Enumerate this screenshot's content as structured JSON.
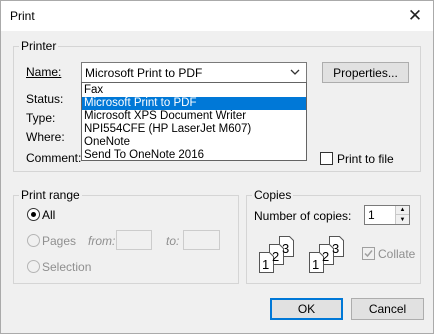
{
  "window": {
    "title": "Print",
    "close_glyph": "✕"
  },
  "printer": {
    "group_label": "Printer",
    "name_label": "Name:",
    "selected": "Microsoft Print to PDF",
    "properties_button": "Properties...",
    "status_label": "Status:",
    "type_label": "Type:",
    "where_label": "Where:",
    "comment_label": "Comment:",
    "print_to_file_label": "Print to file",
    "options": [
      "Fax",
      "Microsoft Print to PDF",
      "Microsoft XPS Document Writer",
      "NPI554CFE (HP LaserJet M607)",
      "OneNote",
      "Send To OneNote 2016"
    ]
  },
  "print_range": {
    "group_label": "Print range",
    "all_label": "All",
    "pages_label": "Pages",
    "from_label": "from:",
    "to_label": "to:",
    "from_value": "",
    "to_value": "",
    "selection_label": "Selection"
  },
  "copies": {
    "group_label": "Copies",
    "number_label": "Number of copies:",
    "value": "1",
    "collate_label": "Collate",
    "page_numbers": [
      "1",
      "2",
      "3"
    ]
  },
  "buttons": {
    "ok": "OK",
    "cancel": "Cancel"
  },
  "colors": {
    "accent": "#0078d7",
    "dialog_bg": "#f0f0f0",
    "disabled_text": "#8f8f8f"
  },
  "icons": {
    "close": "close-icon",
    "dropdown": "chevron-down-icon",
    "spin_up": "spin-up-icon",
    "spin_down": "spin-down-icon",
    "collate": "collate-pages-icon"
  }
}
